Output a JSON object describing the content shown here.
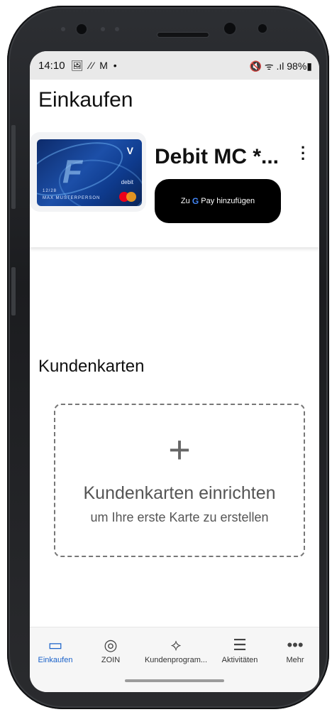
{
  "status_bar": {
    "time": "14:10",
    "left_icons": "🖼 ⁄⁄ M •",
    "right_icons": "🔇 ᯤ .ıl 98%▮"
  },
  "page": {
    "title": "Einkaufen"
  },
  "payment_card": {
    "name": "Debit MC *...",
    "brand_mark": "V",
    "type_label": "debit",
    "expiry": "12/28",
    "holder": "MAX MUSTERPERSON",
    "add_button": {
      "prefix": "Zu",
      "g": "G",
      "suffix": "Pay hinzufügen"
    }
  },
  "loyalty": {
    "section_title": "Kundenkarten",
    "plus": "+",
    "empty_title": "Kundenkarten einrichten",
    "empty_subtitle": "um Ihre erste Karte zu erstellen"
  },
  "nav": {
    "items": [
      {
        "label": "Einkaufen",
        "icon": "card-icon",
        "glyph": "▭",
        "active": true
      },
      {
        "label": "ZOIN",
        "icon": "zoin-icon",
        "glyph": "◎",
        "active": false
      },
      {
        "label": "Kundenprogram...",
        "icon": "ticket-icon",
        "glyph": "⟡",
        "active": false
      },
      {
        "label": "Aktivitäten",
        "icon": "activities-icon",
        "glyph": "☰",
        "active": false
      },
      {
        "label": "Mehr",
        "icon": "more-horizontal-icon",
        "glyph": "•••",
        "active": false
      }
    ]
  },
  "colors": {
    "accent": "#1a62c9",
    "button_bg": "#000000",
    "google_blue": "#4285f4"
  }
}
